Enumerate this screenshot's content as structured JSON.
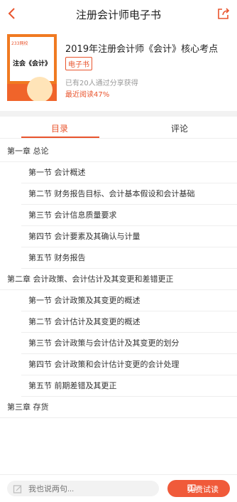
{
  "header": {
    "title": "注册会计师电子书",
    "back_icon": "chevron-left-icon",
    "share_icon": "share-icon"
  },
  "book": {
    "title": "2019年注册会计师《会计》核心考点",
    "tag": "电子书",
    "shared_text": "已有20人通过分享获得",
    "progress_text": "最近阅读47%",
    "cover_title": "注会《会计》",
    "cover_brand": "233网校"
  },
  "tabs": {
    "toc": "目录",
    "comments": "评论"
  },
  "toc": [
    {
      "level": "chapter",
      "label": "第一章 总论"
    },
    {
      "level": "section",
      "label": "第一节 会计概述"
    },
    {
      "level": "section",
      "label": "第二节 财务报告目标、会计基本假设和会计基础"
    },
    {
      "level": "section",
      "label": "第三节 会计信息质量要求"
    },
    {
      "level": "section",
      "label": "第四节 会计要素及其确认与计量"
    },
    {
      "level": "section",
      "label": "第五节 财务报告"
    },
    {
      "level": "chapter",
      "label": "第二章 会计政策、会计估计及其变更和差错更正"
    },
    {
      "level": "section",
      "label": "第一节 会计政策及其变更的概述"
    },
    {
      "level": "section",
      "label": "第二节 会计估计及其变更的概述"
    },
    {
      "level": "section",
      "label": "第三节 会计政策与会计估计及其变更的划分"
    },
    {
      "level": "section",
      "label": "第四节 会计政策和会计估计变更的会计处理"
    },
    {
      "level": "section",
      "label": "第五节 前期差错及其更正"
    },
    {
      "level": "chapter",
      "label": "第三章 存货"
    }
  ],
  "bottom": {
    "comment_placeholder": "我也说两句...",
    "trial_label": "免费试读"
  },
  "colors": {
    "accent": "#e9542d",
    "button": "#f05a3a"
  }
}
